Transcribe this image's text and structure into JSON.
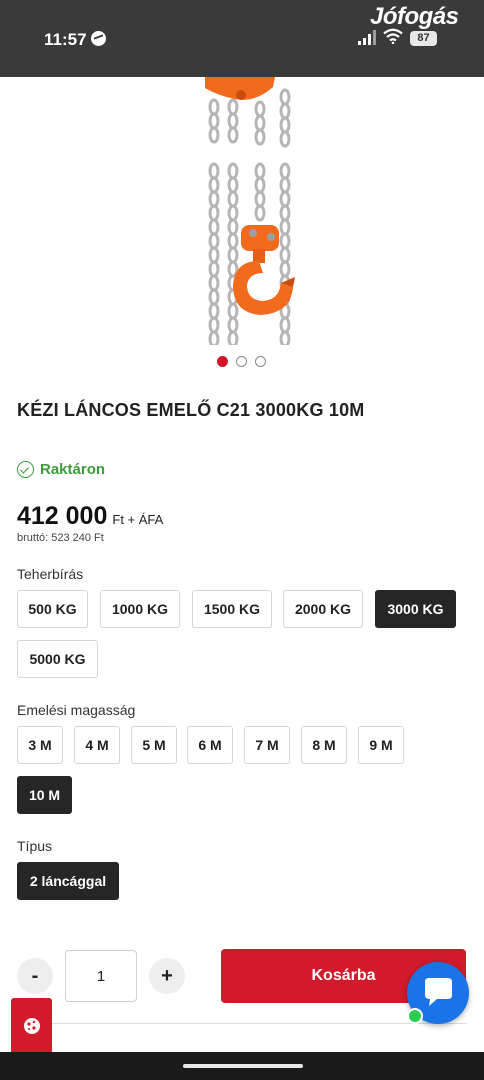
{
  "status_bar": {
    "time": "11:57",
    "brand": "Jófogás",
    "battery": "87"
  },
  "gallery": {
    "image_count": 3,
    "active_index": 0,
    "colors": {
      "hoist": "#f26a1b",
      "chain": "#c9c9c9",
      "active_dot": "#d3142b"
    }
  },
  "product": {
    "title": "KÉZI LÁNCOS EMELŐ C21 3000KG 10M",
    "stock": "Raktáron",
    "price": "412 000",
    "price_unit": "Ft + ÁFA",
    "gross": "bruttó: 523 240 Ft"
  },
  "options": {
    "capacity": {
      "label": "Teherbírás",
      "items": [
        "500 KG",
        "1000 KG",
        "1500 KG",
        "2000 KG",
        "3000 KG",
        "5000 KG"
      ],
      "selected": "3000 KG"
    },
    "height": {
      "label": "Emelési magasság",
      "items": [
        "3 M",
        "4 M",
        "5 M",
        "6 M",
        "7 M",
        "8 M",
        "9 M",
        "10 M"
      ],
      "selected": "10 M"
    },
    "type": {
      "label": "Típus",
      "items": [
        "2 láncággal"
      ],
      "selected": "2 láncággal"
    }
  },
  "cart": {
    "minus": "-",
    "plus": "+",
    "quantity": "1",
    "add_label": "Kosárba"
  },
  "colors": {
    "accent": "#d11a2a",
    "selected_option": "#262626",
    "stock": "#3d9b3d",
    "chat": "#1b73e8"
  }
}
